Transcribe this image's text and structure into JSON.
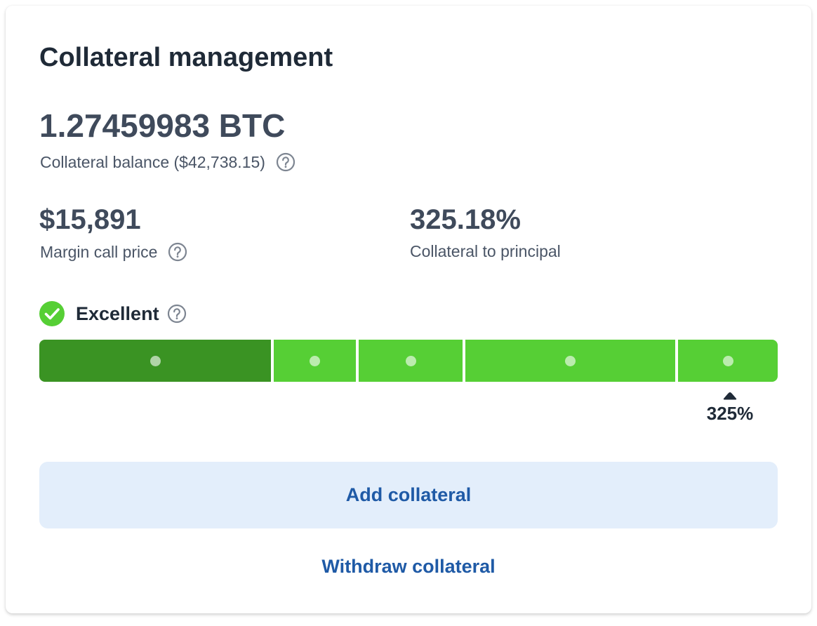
{
  "card": {
    "title": "Collateral management"
  },
  "balance": {
    "value": "1.27459983 BTC",
    "label": "Collateral balance ($42,738.15)",
    "help_icon": "question-circle-icon"
  },
  "margin_call": {
    "value": "$15,891",
    "label": "Margin call price",
    "help_icon": "question-circle-icon"
  },
  "collateral_to_principal": {
    "value": "325.18%",
    "label": "Collateral to principal"
  },
  "health": {
    "status_label": "Excellent",
    "status_icon": "check-circle-icon",
    "help_icon": "question-circle-icon",
    "marker_label": "325%",
    "marker_icon": "caret-up-icon",
    "segments": [
      {
        "color": "#3a9323"
      },
      {
        "color": "#56cf35"
      },
      {
        "color": "#56cf35"
      },
      {
        "color": "#56cf35"
      },
      {
        "color": "#56cf35"
      }
    ]
  },
  "actions": {
    "add_label": "Add collateral",
    "withdraw_label": "Withdraw collateral"
  },
  "colors": {
    "status_check": "#56cf35",
    "link_blue": "#1f5aa6",
    "button_bg": "#e3eefb"
  }
}
